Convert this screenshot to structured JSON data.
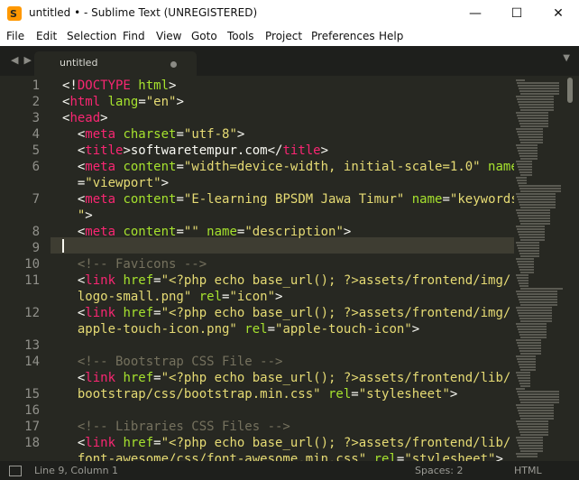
{
  "window": {
    "title": "untitled • - Sublime Text (UNREGISTERED)",
    "controls": [
      "—",
      "☐",
      "✕"
    ]
  },
  "menu": [
    "File",
    "Edit",
    "Selection",
    "Find",
    "View",
    "Goto",
    "Tools",
    "Project",
    "Preferences",
    "Help"
  ],
  "tab": {
    "label": "untitled"
  },
  "gutter_lines": [
    "1",
    "2",
    "3",
    "4",
    "5",
    "6",
    "",
    "7",
    "",
    "8",
    "9",
    "10",
    "11",
    "",
    "12",
    "",
    "13",
    "14",
    "",
    "15",
    "16",
    "17",
    "18",
    ""
  ],
  "code_lines": [
    [
      [
        "<!",
        "w"
      ],
      [
        "DOCTYPE",
        "t"
      ],
      [
        " html",
        "a"
      ],
      [
        ">",
        "w"
      ]
    ],
    [
      [
        "<",
        "w"
      ],
      [
        "html",
        "t"
      ],
      [
        " lang",
        "a"
      ],
      [
        "=",
        "w"
      ],
      [
        "\"en\"",
        "s"
      ],
      [
        ">",
        "w"
      ]
    ],
    [
      [
        "<",
        "w"
      ],
      [
        "head",
        "t"
      ],
      [
        ">",
        "w"
      ]
    ],
    [
      [
        "  <",
        "w"
      ],
      [
        "meta",
        "t"
      ],
      [
        " charset",
        "a"
      ],
      [
        "=",
        "w"
      ],
      [
        "\"utf-8\"",
        "s"
      ],
      [
        ">",
        "w"
      ]
    ],
    [
      [
        "  <",
        "w"
      ],
      [
        "title",
        "t"
      ],
      [
        ">softwaretempur.com</",
        "w"
      ],
      [
        "title",
        "t"
      ],
      [
        ">",
        "w"
      ]
    ],
    [
      [
        "  <",
        "w"
      ],
      [
        "meta",
        "t"
      ],
      [
        " content",
        "a"
      ],
      [
        "=",
        "w"
      ],
      [
        "\"width=device-width, initial-scale=1.0\"",
        "s"
      ],
      [
        " name",
        "a"
      ]
    ],
    [
      [
        "  =",
        "w"
      ],
      [
        "\"viewport\"",
        "s"
      ],
      [
        ">",
        "w"
      ]
    ],
    [
      [
        "  <",
        "w"
      ],
      [
        "meta",
        "t"
      ],
      [
        " content",
        "a"
      ],
      [
        "=",
        "w"
      ],
      [
        "\"E-learning BPSDM Jawa Timur\"",
        "s"
      ],
      [
        " name",
        "a"
      ],
      [
        "=",
        "w"
      ],
      [
        "\"keywords",
        "s"
      ]
    ],
    [
      [
        "  \"",
        "s"
      ],
      [
        ">",
        "w"
      ]
    ],
    [
      [
        "  <",
        "w"
      ],
      [
        "meta",
        "t"
      ],
      [
        " content",
        "a"
      ],
      [
        "=",
        "w"
      ],
      [
        "\"\"",
        "s"
      ],
      [
        " name",
        "a"
      ],
      [
        "=",
        "w"
      ],
      [
        "\"description\"",
        "s"
      ],
      [
        ">",
        "w"
      ]
    ],
    [
      [
        "",
        "w"
      ]
    ],
    [
      [
        "  <!-- Favicons -->",
        "c"
      ]
    ],
    [
      [
        "  <",
        "w"
      ],
      [
        "link",
        "t"
      ],
      [
        " href",
        "a"
      ],
      [
        "=",
        "w"
      ],
      [
        "\"<?php echo base_url(); ?>assets/frontend/img/",
        "s"
      ]
    ],
    [
      [
        "  logo-small.png\"",
        "s"
      ],
      [
        " rel",
        "a"
      ],
      [
        "=",
        "w"
      ],
      [
        "\"icon\"",
        "s"
      ],
      [
        ">",
        "w"
      ]
    ],
    [
      [
        "  <",
        "w"
      ],
      [
        "link",
        "t"
      ],
      [
        " href",
        "a"
      ],
      [
        "=",
        "w"
      ],
      [
        "\"<?php echo base_url(); ?>assets/frontend/img/",
        "s"
      ]
    ],
    [
      [
        "  apple-touch-icon.png\"",
        "s"
      ],
      [
        " rel",
        "a"
      ],
      [
        "=",
        "w"
      ],
      [
        "\"apple-touch-icon\"",
        "s"
      ],
      [
        ">",
        "w"
      ]
    ],
    [
      [
        "",
        "w"
      ]
    ],
    [
      [
        "  <!-- Bootstrap CSS File -->",
        "c"
      ]
    ],
    [
      [
        "  <",
        "w"
      ],
      [
        "link",
        "t"
      ],
      [
        " href",
        "a"
      ],
      [
        "=",
        "w"
      ],
      [
        "\"<?php echo base_url(); ?>assets/frontend/lib/",
        "s"
      ]
    ],
    [
      [
        "  bootstrap/css/bootstrap.min.css\"",
        "s"
      ],
      [
        " rel",
        "a"
      ],
      [
        "=",
        "w"
      ],
      [
        "\"stylesheet\"",
        "s"
      ],
      [
        ">",
        "w"
      ]
    ],
    [
      [
        "",
        "w"
      ]
    ],
    [
      [
        "  <!-- Libraries CSS Files -->",
        "c"
      ]
    ],
    [
      [
        "  <",
        "w"
      ],
      [
        "link",
        "t"
      ],
      [
        " href",
        "a"
      ],
      [
        "=",
        "w"
      ],
      [
        "\"<?php echo base_url(); ?>assets/frontend/lib/",
        "s"
      ]
    ],
    [
      [
        "  font-awesome/css/font-awesome.min.css\"",
        "s"
      ],
      [
        " rel",
        "a"
      ],
      [
        "=",
        "w"
      ],
      [
        "\"stylesheet\"",
        "s"
      ],
      [
        ">",
        "w"
      ]
    ]
  ],
  "status": {
    "position": "Line 9, Column 1",
    "spaces": "Spaces: 2",
    "syntax": "HTML"
  }
}
